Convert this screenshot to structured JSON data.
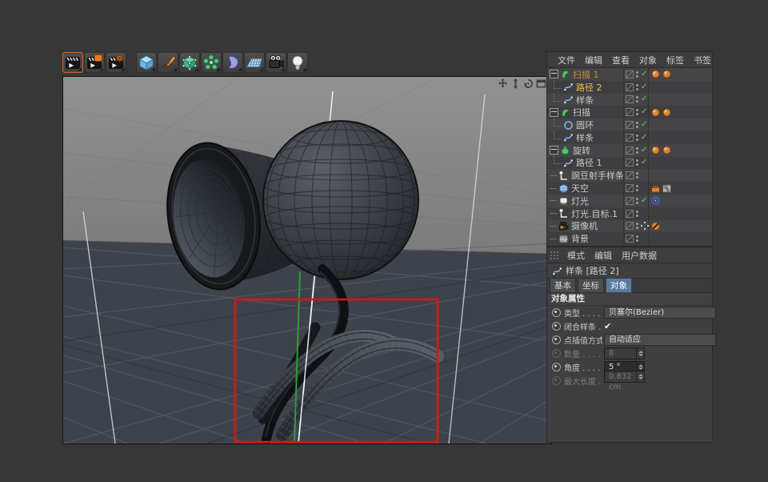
{
  "colors": {
    "accent_orange": "#d8873a",
    "selected_text": "#ecbc4e",
    "parent_selected_text": "#c9882e",
    "check_green": "#6fc57f",
    "tab_active_blue": "#5a7aa0",
    "annotation_red": "#e01212",
    "axis_green": "#2e9e38"
  },
  "toolbar": {
    "buttons": [
      {
        "name": "render-view-button",
        "icon": "clapper-icon",
        "highlighted": true
      },
      {
        "name": "render-to-picture-viewer-button",
        "icon": "clapper-picture-icon",
        "highlighted": false
      },
      {
        "name": "edit-render-settings-button",
        "icon": "clapper-gear-icon",
        "highlighted": false
      },
      {
        "name": "add-cube-primitive-button",
        "icon": "cube-icon",
        "highlighted": false
      },
      {
        "name": "spline-pen-button",
        "icon": "pen-icon",
        "highlighted": false
      },
      {
        "name": "subdivision-surface-button",
        "icon": "subdiv-cube-icon",
        "highlighted": false
      },
      {
        "name": "generators-button",
        "icon": "flower-icon",
        "highlighted": false
      },
      {
        "name": "deformers-button",
        "icon": "bean-icon",
        "highlighted": false
      },
      {
        "name": "environment-floor-button",
        "icon": "floor-icon",
        "highlighted": false
      },
      {
        "name": "camera-button",
        "icon": "camera-icon",
        "highlighted": false
      },
      {
        "name": "lights-button",
        "icon": "bulb-icon",
        "highlighted": false
      }
    ]
  },
  "viewport": {
    "annotation_color": "#e01212",
    "nav_icons": [
      "pan-icon",
      "dolly-icon",
      "rotate-icon",
      "toggle-view-icon"
    ]
  },
  "object_manager": {
    "menu": [
      "文件",
      "编辑",
      "查看",
      "对象",
      "标签",
      "书签"
    ],
    "rows": [
      {
        "label": "扫描 1",
        "icon": "sweep-icon",
        "depth": 0,
        "expand": true,
        "state": "parentsel",
        "check": true,
        "tags": [
          "sphere-tag",
          "sphere-tag"
        ]
      },
      {
        "label": "路径 2",
        "icon": "spline-icon",
        "depth": 1,
        "state": "sel",
        "check": true,
        "tags": []
      },
      {
        "label": "样条",
        "icon": "spline-icon",
        "depth": 1,
        "state": "",
        "check": true,
        "tags": []
      },
      {
        "label": "扫描",
        "icon": "sweep-icon",
        "depth": 0,
        "expand": true,
        "state": "",
        "check": true,
        "tags": [
          "sphere-tag",
          "sphere-tag"
        ]
      },
      {
        "label": "圆环",
        "icon": "circle-icon",
        "depth": 1,
        "state": "",
        "check": true,
        "tags": []
      },
      {
        "label": "样条",
        "icon": "spline-icon",
        "depth": 1,
        "state": "",
        "check": true,
        "tags": []
      },
      {
        "label": "旋转",
        "icon": "lathe-icon",
        "depth": 0,
        "expand": true,
        "state": "",
        "check": true,
        "tags": [
          "sphere-tag",
          "sphere-tag"
        ]
      },
      {
        "label": "路径 1",
        "icon": "spline-icon",
        "depth": 1,
        "state": "",
        "check": true,
        "tags": []
      },
      {
        "label": "豌豆射手样条线",
        "icon": "null-icon",
        "depth": 0,
        "state": "",
        "check": false,
        "tags": []
      },
      {
        "label": "天空",
        "icon": "sky-icon",
        "depth": 0,
        "state": "",
        "check": false,
        "tags": [
          "compositing-tag",
          "texture-tag"
        ]
      },
      {
        "label": "灯光",
        "icon": "light-icon",
        "depth": 0,
        "state": "",
        "check": true,
        "tags": [
          "target-tag"
        ]
      },
      {
        "label": "灯光.目标.1",
        "icon": "null-icon",
        "depth": 0,
        "state": "",
        "check": false,
        "tags": []
      },
      {
        "label": "摄像机",
        "icon": "camera-small-icon",
        "depth": 0,
        "state": "",
        "check": false,
        "special": "crosshair",
        "tags": [
          "protection-tag"
        ]
      },
      {
        "label": "背景",
        "icon": "background-icon",
        "depth": 0,
        "state": "",
        "check": false,
        "tags": []
      }
    ]
  },
  "attribute_manager": {
    "menu": [
      "模式",
      "编辑",
      "用户数据"
    ],
    "object_title": "样条 [路径 2]",
    "object_icon": "spline-icon",
    "tabs": [
      {
        "label": "基本",
        "active": false
      },
      {
        "label": "坐标",
        "active": false
      },
      {
        "label": "对象",
        "active": true
      }
    ],
    "section_title": "对象属性",
    "fields": [
      {
        "label": "类型",
        "dots": ". . . . .",
        "type": "dropdown",
        "value": "贝塞尔(Bezier)",
        "enabled": true
      },
      {
        "label": "闭合样条",
        "dots": ". .",
        "type": "check",
        "value": "✔",
        "enabled": true
      },
      {
        "label": "点插值方式",
        "dots": "",
        "type": "dropdown",
        "value": "自动适应",
        "enabled": true
      },
      {
        "label": "数量",
        "dots": ". . . . .",
        "type": "spinner",
        "value": "8",
        "enabled": false
      },
      {
        "label": "角度",
        "dots": ". . . . .",
        "type": "spinner",
        "value": "5 °",
        "enabled": true
      },
      {
        "label": "最大长度",
        "dots": ". .",
        "type": "spinner",
        "value": "0.832 cm",
        "enabled": false
      }
    ]
  }
}
